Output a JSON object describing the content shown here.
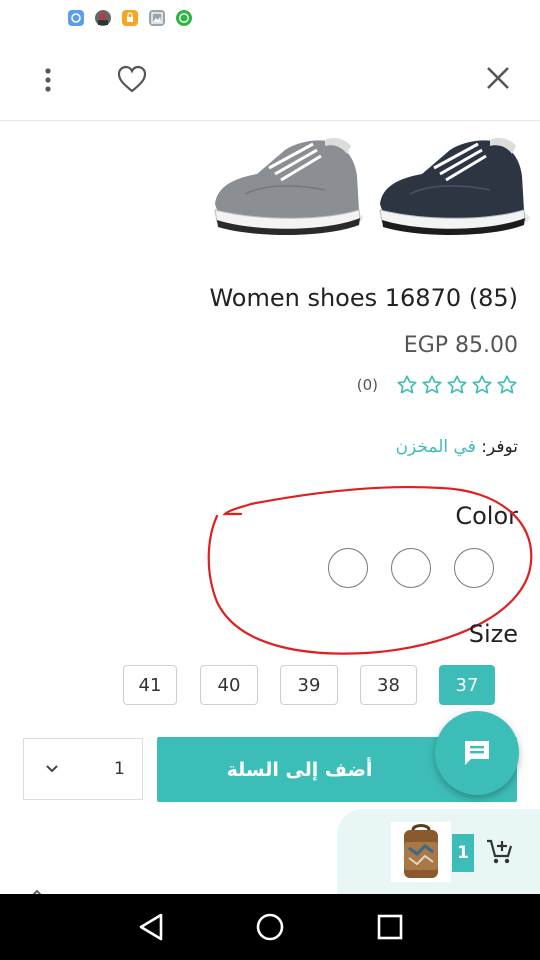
{
  "status_bar": {
    "icons": [
      "link-notification-icon",
      "avatar-notification-icon",
      "lock-notification-icon",
      "image-notification-icon",
      "whatsapp-notification-icon"
    ]
  },
  "top_bar": {
    "icons": [
      "more-vert-icon",
      "heart-icon",
      "close-icon"
    ]
  },
  "gallery": {
    "images": [
      "grey-shoe-image",
      "navy-shoe-image"
    ]
  },
  "product": {
    "title": "Women shoes 16870 (85)",
    "price": "EGP 85.00",
    "rating": 0,
    "rating_max": 5,
    "review_count": "(0)",
    "availability_label": "توفر:",
    "availability_value": "في المخزن"
  },
  "options": {
    "color_label": "Color",
    "color_swatches": 3,
    "size_label": "Size",
    "sizes": [
      "41",
      "40",
      "39",
      "38",
      "37"
    ],
    "selected_size": "37"
  },
  "cart": {
    "quantity": "1",
    "add_to_cart_label": "أضف إلى السلة",
    "mini_cart_count": "1"
  },
  "colors": {
    "accent": "#3dbdb7",
    "annotation": "#e02020",
    "mini_cart_bg": "#e8f6f5"
  }
}
